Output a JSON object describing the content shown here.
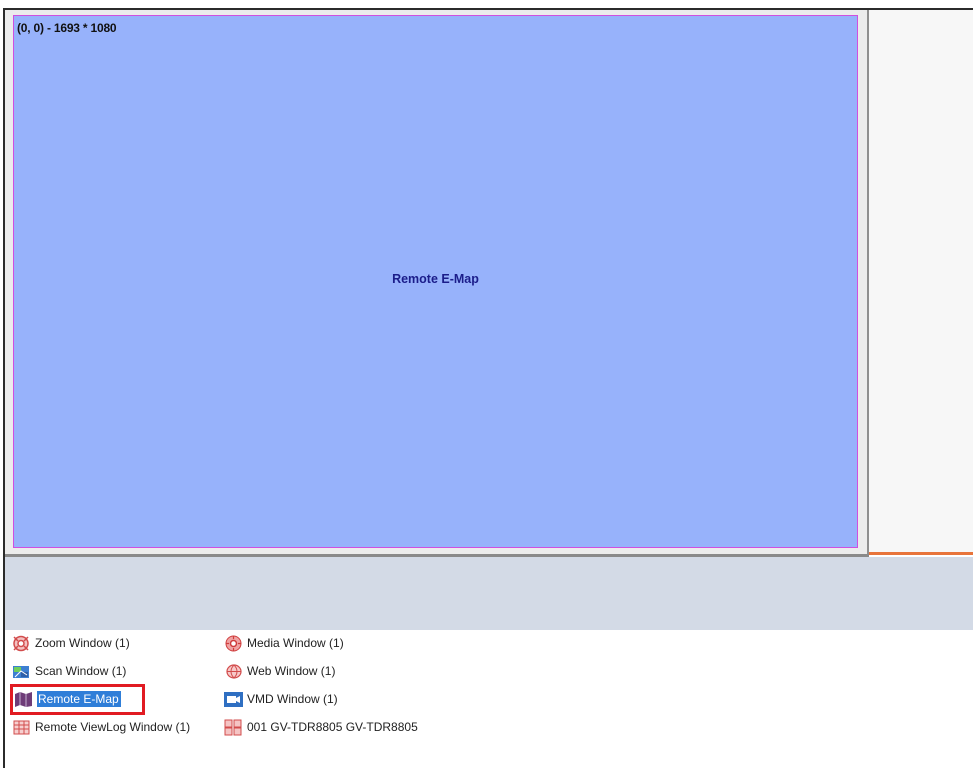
{
  "map_panel": {
    "coordinate_readout": "(0, 0) - 1693 * 1080",
    "center_label": "Remote E-Map"
  },
  "window_list": {
    "column1": [
      {
        "label": "Zoom Window (1)",
        "icon": "zoom-window-icon"
      },
      {
        "label": "Scan Window (1)",
        "icon": "scan-window-icon"
      },
      {
        "label": "Remote E-Map",
        "icon": "remote-emap-icon",
        "selected": true
      },
      {
        "label": "Remote ViewLog Window (1)",
        "icon": "remote-viewlog-icon"
      }
    ],
    "column2": [
      {
        "label": "Media Window (1)",
        "icon": "media-window-icon"
      },
      {
        "label": "Web Window (1)",
        "icon": "web-window-icon"
      },
      {
        "label": "VMD Window (1)",
        "icon": "vmd-window-icon"
      },
      {
        "label": "001 GV-TDR8805 GV-TDR8805",
        "icon": "camera-device-icon"
      }
    ]
  },
  "colors": {
    "map_fill": "#97b2fb",
    "map_border": "#d04fe0",
    "selection_highlight": "#2f7ed8",
    "selection_outline": "#e11b22",
    "accent": "#e8743b"
  }
}
